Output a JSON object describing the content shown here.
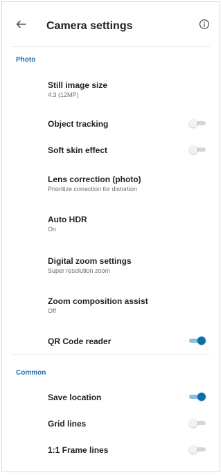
{
  "header": {
    "title": "Camera settings",
    "back_icon": "arrow-left-icon",
    "info_icon": "info-icon"
  },
  "sections": {
    "photo": {
      "label": "Photo",
      "items": [
        {
          "label": "Still image size",
          "sub": "4:3 (12MP)"
        },
        {
          "label": "Object tracking",
          "toggle": false
        },
        {
          "label": "Soft skin effect",
          "toggle": false
        },
        {
          "label": "Lens correction (photo)",
          "sub": "Prioritize correction for distortion"
        },
        {
          "label": "Auto HDR",
          "sub": "On"
        },
        {
          "label": "Digital zoom settings",
          "sub": "Super resolution zoom"
        },
        {
          "label": "Zoom composition assist",
          "sub": "Off"
        },
        {
          "label": "QR Code reader",
          "toggle": true
        }
      ]
    },
    "common": {
      "label": "Common",
      "items": [
        {
          "label": "Save location",
          "toggle": true
        },
        {
          "label": "Grid lines",
          "toggle": false
        },
        {
          "label": "1:1 Frame lines",
          "toggle": false
        }
      ]
    }
  },
  "colors": {
    "accent": "#1f6fb2",
    "toggle_on": "#0b6ea7",
    "toggle_track_on": "#8fbfe0",
    "toggle_off": "#d6d6d6"
  }
}
